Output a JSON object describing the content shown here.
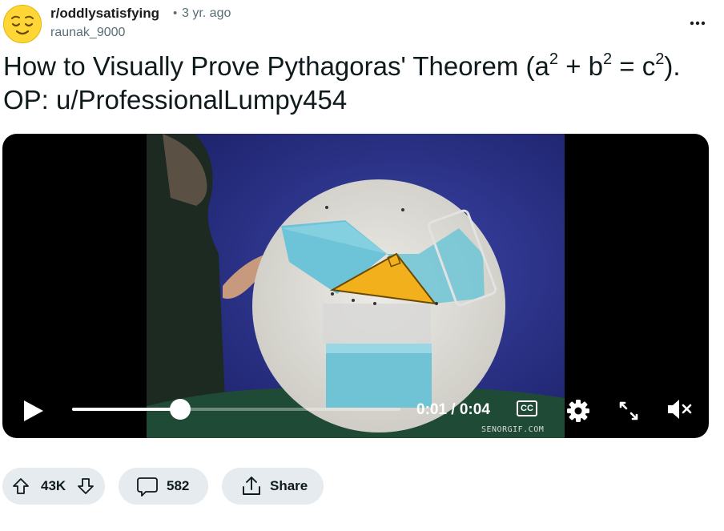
{
  "post": {
    "subreddit": "r/oddlysatisfying",
    "separator": "•",
    "time_ago": "3 yr. ago",
    "author": "raunak_9000",
    "title": {
      "part1": "How to Visually Prove Pythagoras' Theorem (a",
      "sup1": "2",
      "part2": " + b",
      "sup2": "2",
      "part3": " = c",
      "sup3": "2",
      "part4": "). OP: u/ProfessionalLumpy454"
    },
    "overflow_icon": "more-horizontal-icon"
  },
  "video": {
    "timecode": "0:01 / 0:04",
    "progress": 0.33,
    "cc_label": "CC",
    "watermark": "SENORGIF.COM",
    "icons": [
      "play-icon",
      "captions-icon",
      "settings-icon",
      "fullscreen-icon",
      "mute-icon"
    ]
  },
  "actions": {
    "score": "43K",
    "comments": "582",
    "share_label": "Share",
    "icons": [
      "upvote-icon",
      "downvote-icon",
      "comment-icon",
      "share-icon"
    ]
  },
  "colors": {
    "pill_bg": "#e5ebee",
    "meta_gray": "#576f76",
    "video_bg": "#000000"
  }
}
